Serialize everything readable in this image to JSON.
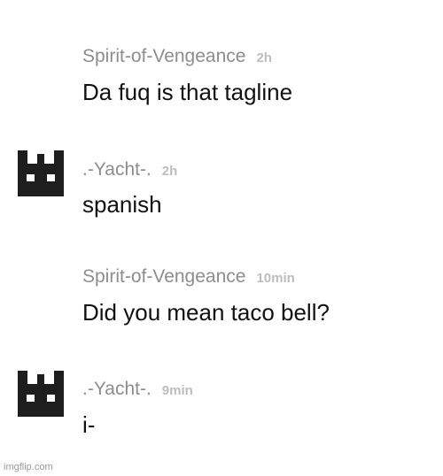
{
  "messages": [
    {
      "author": "Spirit-of-Vengeance",
      "time": "2h",
      "text": "Da fuq is that tagline",
      "avatar": null
    },
    {
      "author": ".-Yacht-.",
      "time": "2h",
      "text": "spanish",
      "avatar": "pixel-cat-avatar"
    },
    {
      "author": "Spirit-of-Vengeance",
      "time": "10min",
      "text": "Did you mean taco bell?",
      "avatar": null
    },
    {
      "author": ".-Yacht-.",
      "time": "9min",
      "text": "i-",
      "avatar": "pixel-cat-avatar"
    }
  ],
  "watermark": "imgflip.com",
  "colors": {
    "author": "#8d8d8d",
    "time": "#bdbdbd",
    "text": "#111111",
    "avatar": "#1e1e1e",
    "background": "#ffffff"
  }
}
